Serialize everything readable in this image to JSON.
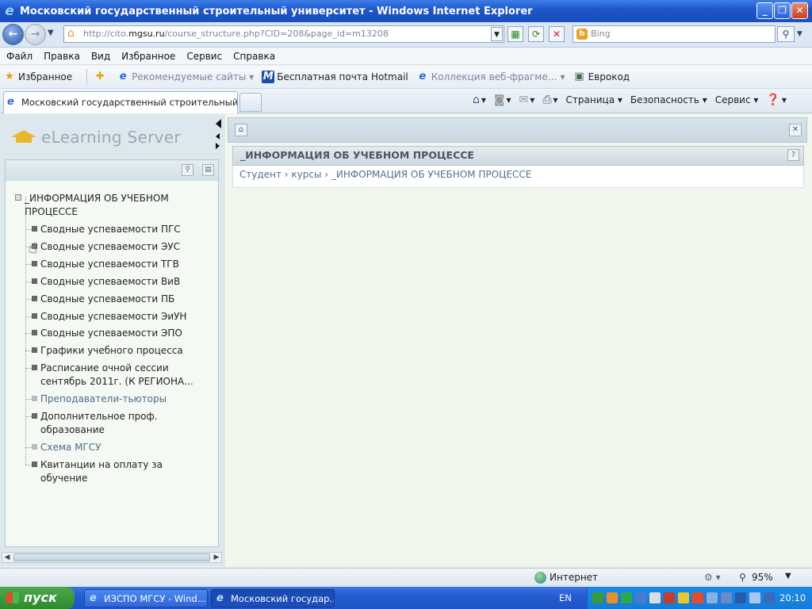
{
  "window": {
    "title": "Московский государственный строительный университет - Windows Internet Explorer"
  },
  "address": {
    "url_prefix": "http://cito.",
    "url_domain": "mgsu.ru",
    "url_rest": "/course_structure.php?CID=208&page_id=m13208",
    "search_placeholder": "Bing"
  },
  "menu": [
    "Файл",
    "Правка",
    "Вид",
    "Избранное",
    "Сервис",
    "Справка"
  ],
  "favorites": {
    "label": "Избранное",
    "items": [
      "Рекомендуемые сайты ▾",
      "Бесплатная почта Hotmail",
      "Коллекция веб-фрагме… ▾",
      "Еврокод"
    ]
  },
  "tab": {
    "title": "Московский государственный строительный унив..."
  },
  "commands": [
    "Страница ▾",
    "Безопасность ▾",
    "Сервис ▾"
  ],
  "sidebar": {
    "logo": "eLearning Server",
    "root": "_ИНФОРМАЦИЯ ОБ УЧЕБНОМ ПРОЦЕССЕ",
    "items": [
      "Сводные успеваемости ПГС",
      "Сводные успеваемости ЭУС",
      "Сводные успеваемости ТГВ",
      "Сводные успеваемости ВиВ",
      "Сводные успеваемости ПБ",
      "Сводные успеваемости ЭиУН",
      "Сводные успеваемости ЭПО",
      "Графики учебного процесса",
      "Расписание очной сессии сентябрь 2011г. (К РЕГИОНА...",
      "Преподаватели-тьюторы",
      "Дополнительное проф. образование",
      "Схема МГСУ",
      "Квитанции на оплату за обучение"
    ]
  },
  "main": {
    "title": "_ИНФОРМАЦИЯ ОБ УЧЕБНОМ ПРОЦЕССЕ",
    "breadcrumb": "Студент › курсы › _ИНФОРМАЦИЯ ОБ УЧЕБНОМ ПРОЦЕССЕ"
  },
  "status": {
    "zone": "Интернет",
    "zoom": "95%"
  },
  "taskbar": {
    "start": "пуск",
    "tasks": [
      "ИЗСПО МГСУ - Wind...",
      "Московский государ..."
    ],
    "lang": "EN",
    "time": "20:10"
  }
}
